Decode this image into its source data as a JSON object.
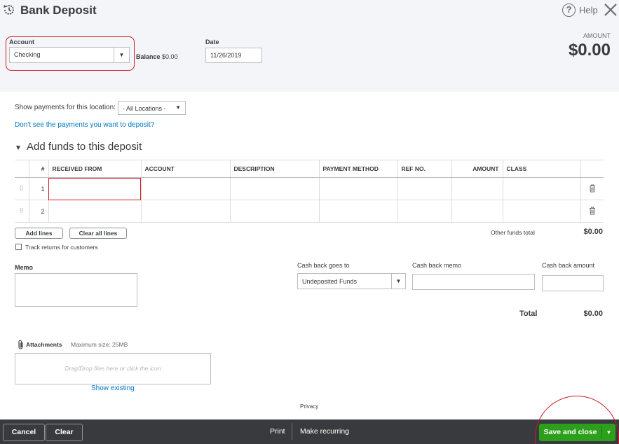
{
  "header": {
    "title": "Bank Deposit",
    "help_label": "Help",
    "account_label": "Account",
    "account_value": "Checking",
    "balance_label": "Balance",
    "balance_value": "$0.00",
    "date_label": "Date",
    "date_value": "11/26/2019",
    "amount_caption": "AMOUNT",
    "amount_value": "$0.00"
  },
  "filters": {
    "show_payments_label": "Show payments for this location:",
    "location_value": "- All Locations -",
    "dont_see_link": "Don't see the payments you want to deposit?"
  },
  "section": {
    "title": "Add funds to this deposit"
  },
  "table": {
    "headers": [
      "#",
      "RECEIVED FROM",
      "ACCOUNT",
      "DESCRIPTION",
      "PAYMENT METHOD",
      "REF NO.",
      "AMOUNT",
      "CLASS"
    ],
    "rows": [
      {
        "num": "1"
      },
      {
        "num": "2"
      }
    ]
  },
  "lines": {
    "add_lines": "Add lines",
    "clear_all_lines": "Clear all lines",
    "other_funds_total_label": "Other funds total",
    "other_funds_total_value": "$0.00",
    "track_returns_label": "Track returns for customers"
  },
  "cashback": {
    "memo_label": "Memo",
    "goes_to_label": "Cash back goes to",
    "goes_to_value": "Undeposited Funds",
    "memo_field_label": "Cash back memo",
    "amount_label": "Cash back amount"
  },
  "totals": {
    "total_label": "Total",
    "total_value": "$0.00"
  },
  "attachments": {
    "label": "Attachments",
    "max_size": "Maximum size: 25MB",
    "drop_hint": "Drag/Drop files here or click the icon",
    "show_existing": "Show existing"
  },
  "privacy": "Privacy",
  "footer": {
    "cancel": "Cancel",
    "clear": "Clear",
    "print": "Print",
    "make_recurring": "Make recurring",
    "save_and_close": "Save and close"
  },
  "colors": {
    "save_green": "#2ca01c",
    "link_blue": "#0077c5",
    "highlight_red": "#cc1b23",
    "footer_bg": "#393a3d"
  }
}
